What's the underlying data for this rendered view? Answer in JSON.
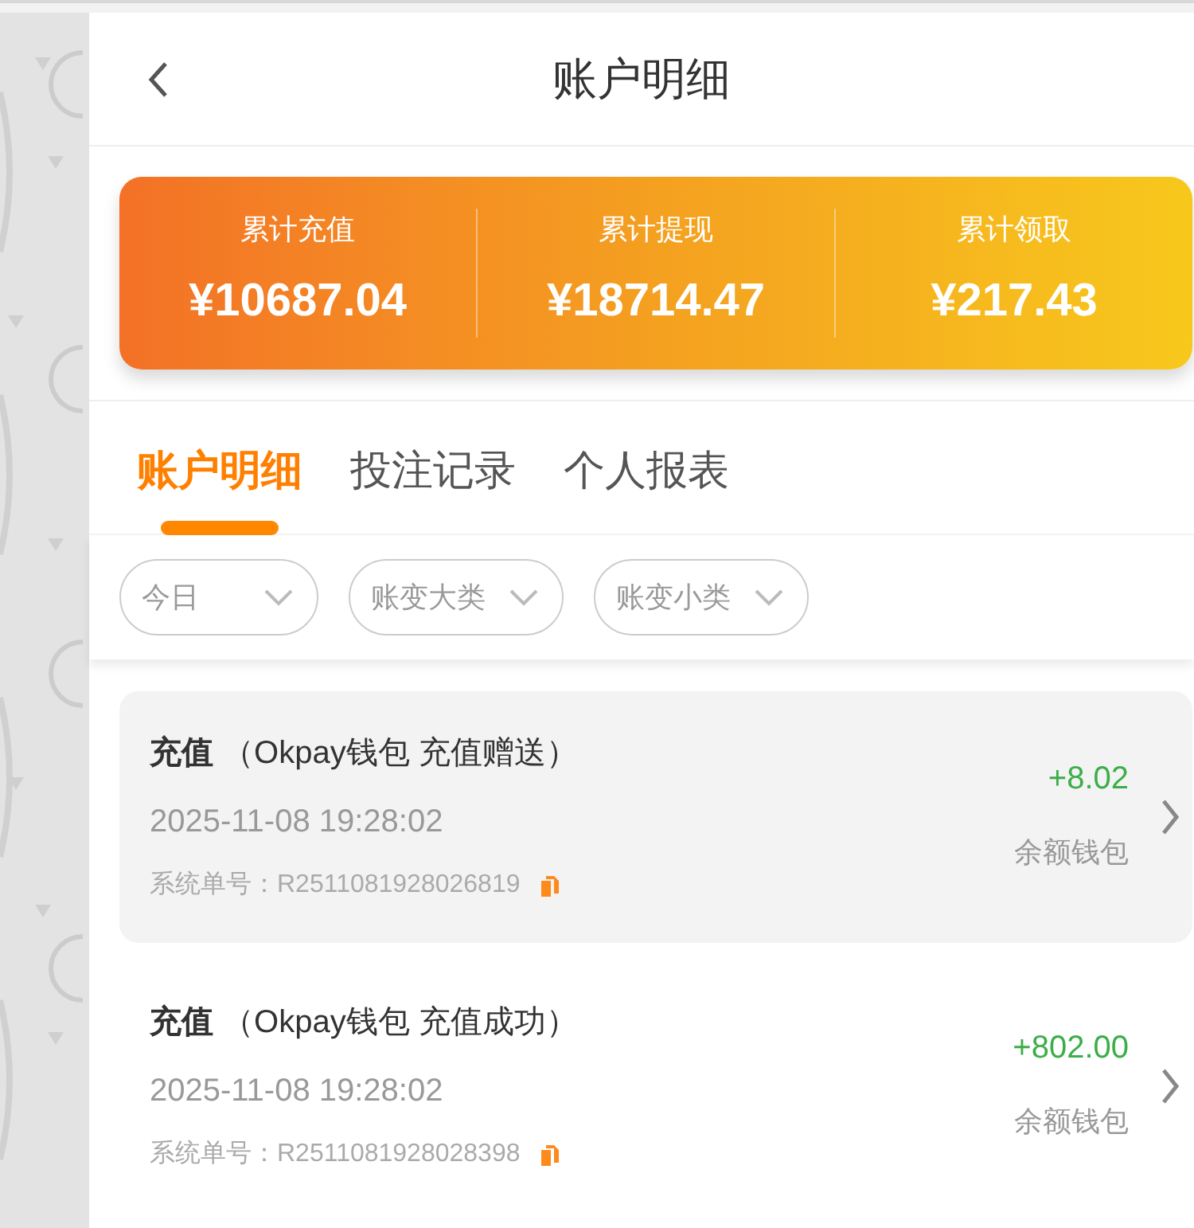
{
  "header": {
    "title": "账户明细"
  },
  "summary": [
    {
      "label": "累计充值",
      "amount": "¥10687.04"
    },
    {
      "label": "累计提现",
      "amount": "¥18714.47"
    },
    {
      "label": "累计领取",
      "amount": "¥217.43"
    }
  ],
  "tabs": [
    {
      "label": "账户明细",
      "selected": true
    },
    {
      "label": "投注记录",
      "selected": false
    },
    {
      "label": "个人报表",
      "selected": false
    }
  ],
  "filters": [
    {
      "label": "今日"
    },
    {
      "label": "账变大类"
    },
    {
      "label": "账变小类"
    }
  ],
  "records": [
    {
      "title": "**充值** （Okpay钱包 充值赠送）",
      "time": "2025-11-08 19:28:02",
      "order": "系统单号：R2511081928026819",
      "amount": "+8.02",
      "wallet": "余额钱包",
      "selected": true
    },
    {
      "title": "**充值** （Okpay钱包 充值成功）",
      "time": "2025-11-08 19:28:02",
      "order": "系统单号：R2511081928028398",
      "amount": "+802.00",
      "wallet": "余额钱包",
      "selected": false
    }
  ]
}
